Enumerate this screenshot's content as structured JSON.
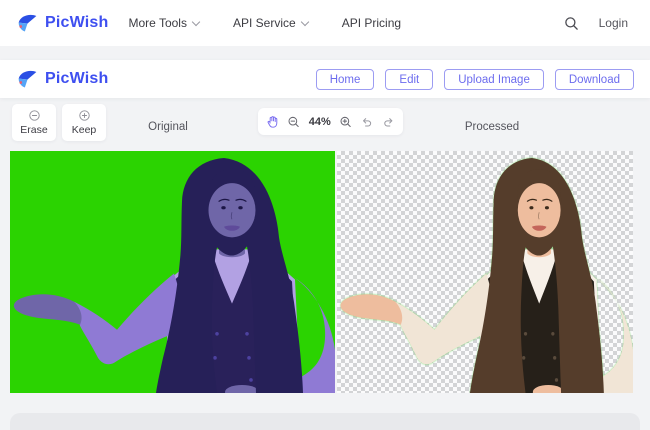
{
  "topnav": {
    "brand": "PicWish",
    "items": [
      {
        "label": "More Tools"
      },
      {
        "label": "API Service"
      },
      {
        "label": "API Pricing"
      }
    ],
    "login_label": "Login"
  },
  "editor_header": {
    "brand": "PicWish",
    "buttons": [
      {
        "label": "Home"
      },
      {
        "label": "Edit"
      },
      {
        "label": "Upload Image"
      },
      {
        "label": "Download"
      }
    ]
  },
  "toolbar": {
    "erase_label": "Erase",
    "keep_label": "Keep",
    "zoom_level": "44%"
  },
  "panels": {
    "original_label": "Original",
    "processed_label": "Processed"
  },
  "colors": {
    "brand_blue": "#3E4FF0",
    "button_purple": "#6C6CEE",
    "chroma_green": "#2BD301",
    "hand_tool_purple": "#7A6DF0",
    "page_bg": "#F2F3F5"
  }
}
